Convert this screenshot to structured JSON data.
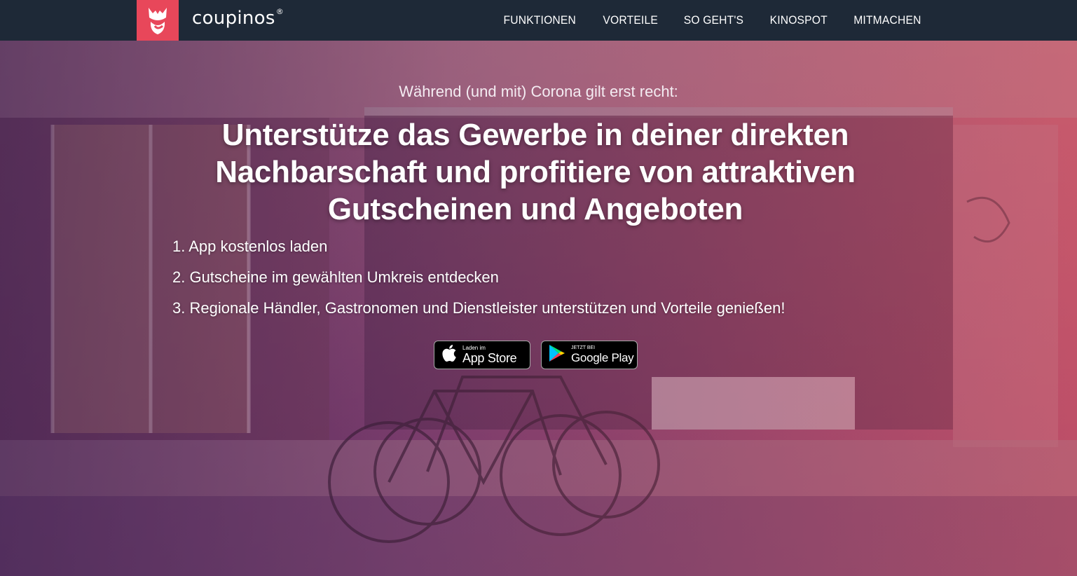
{
  "brand": {
    "name": "coupinos",
    "mark": "®",
    "logo_bg": "#e8475a"
  },
  "nav": {
    "items": [
      {
        "label": "FUNKTIONEN"
      },
      {
        "label": "VORTEILE"
      },
      {
        "label": "SO GEHT'S"
      },
      {
        "label": "KINOSPOT"
      },
      {
        "label": "MITMACHEN"
      }
    ]
  },
  "hero": {
    "kicker": "Während (und mit) Corona gilt erst recht:",
    "headline": "Unterstütze das Gewerbe in deiner direkten Nachbarschaft und profitiere von attraktiven Gutscheinen und Angeboten",
    "steps": [
      "1. App kostenlos laden",
      "2. Gutscheine im gewählten Umkreis entdecken",
      "3. Regionale Händler, Gastronomen und Dienstleister unterstützen und Vorteile genießen!"
    ]
  },
  "stores": {
    "appstore": {
      "small": "Laden im",
      "big": "App Store",
      "icon": "apple-icon"
    },
    "googleplay": {
      "small": "JETZT BEI",
      "big": "Google Play",
      "icon": "google-play-icon"
    }
  },
  "colors": {
    "navbar": "#1e2937",
    "accent": "#e8475a"
  }
}
